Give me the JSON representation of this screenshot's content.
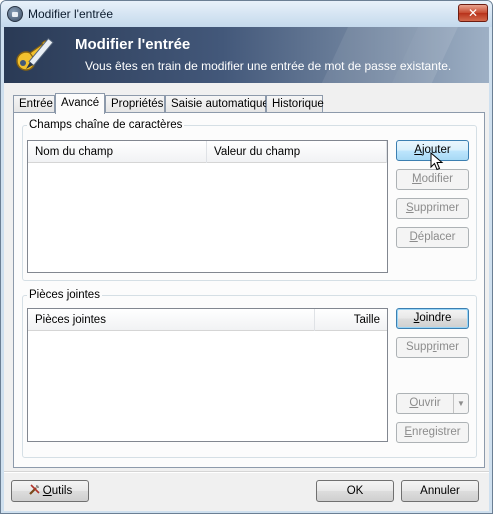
{
  "window": {
    "title": "Modifier l'entrée",
    "close_label": "✕"
  },
  "banner": {
    "title": "Modifier l'entrée",
    "subtitle": "Vous êtes en train de modifier une entrée de mot de passe existante."
  },
  "tabs": [
    {
      "label": "Entrée",
      "active": false
    },
    {
      "label": "Avancé",
      "active": true
    },
    {
      "label": "Propriétés",
      "active": false
    },
    {
      "label": "Saisie automatique",
      "active": false
    },
    {
      "label": "Historique",
      "active": false
    }
  ],
  "strings_group": {
    "legend": "Champs chaîne de caractères",
    "columns": [
      "Nom du champ",
      "Valeur du champ"
    ],
    "rows": [],
    "buttons": {
      "add": {
        "pre": "",
        "key": "A",
        "post": "jouter"
      },
      "edit": {
        "pre": "",
        "key": "M",
        "post": "odifier"
      },
      "delete": {
        "pre": "",
        "key": "S",
        "post": "upprimer"
      },
      "move": {
        "pre": "",
        "key": "D",
        "post": "éplacer"
      }
    }
  },
  "attachments_group": {
    "legend": "Pièces jointes",
    "columns": [
      "Pièces jointes",
      "Taille"
    ],
    "rows": [],
    "buttons": {
      "attach": {
        "pre": "",
        "key": "J",
        "post": "oindre"
      },
      "delete": {
        "pre": "Supp",
        "key": "r",
        "post": "imer"
      },
      "open": {
        "pre": "",
        "key": "O",
        "post": "uvrir"
      },
      "save": {
        "pre": "",
        "key": "E",
        "post": "nregistrer"
      }
    }
  },
  "footer": {
    "tools": {
      "pre": "",
      "key": "O",
      "post": "utils"
    },
    "ok_label": "OK",
    "cancel_label": "Annuler"
  },
  "icons": {
    "app": "lock-icon",
    "banner": "key-pencil-icon",
    "tools": "tools-icon",
    "open_split": "chevron-down-icon",
    "pointer": "mouse-pointer-icon"
  },
  "colors": {
    "banner_start": "#2a3a55",
    "banner_end": "#9eb0c5",
    "hover_button": "#bee6fd",
    "close_button": "#c6492f"
  }
}
